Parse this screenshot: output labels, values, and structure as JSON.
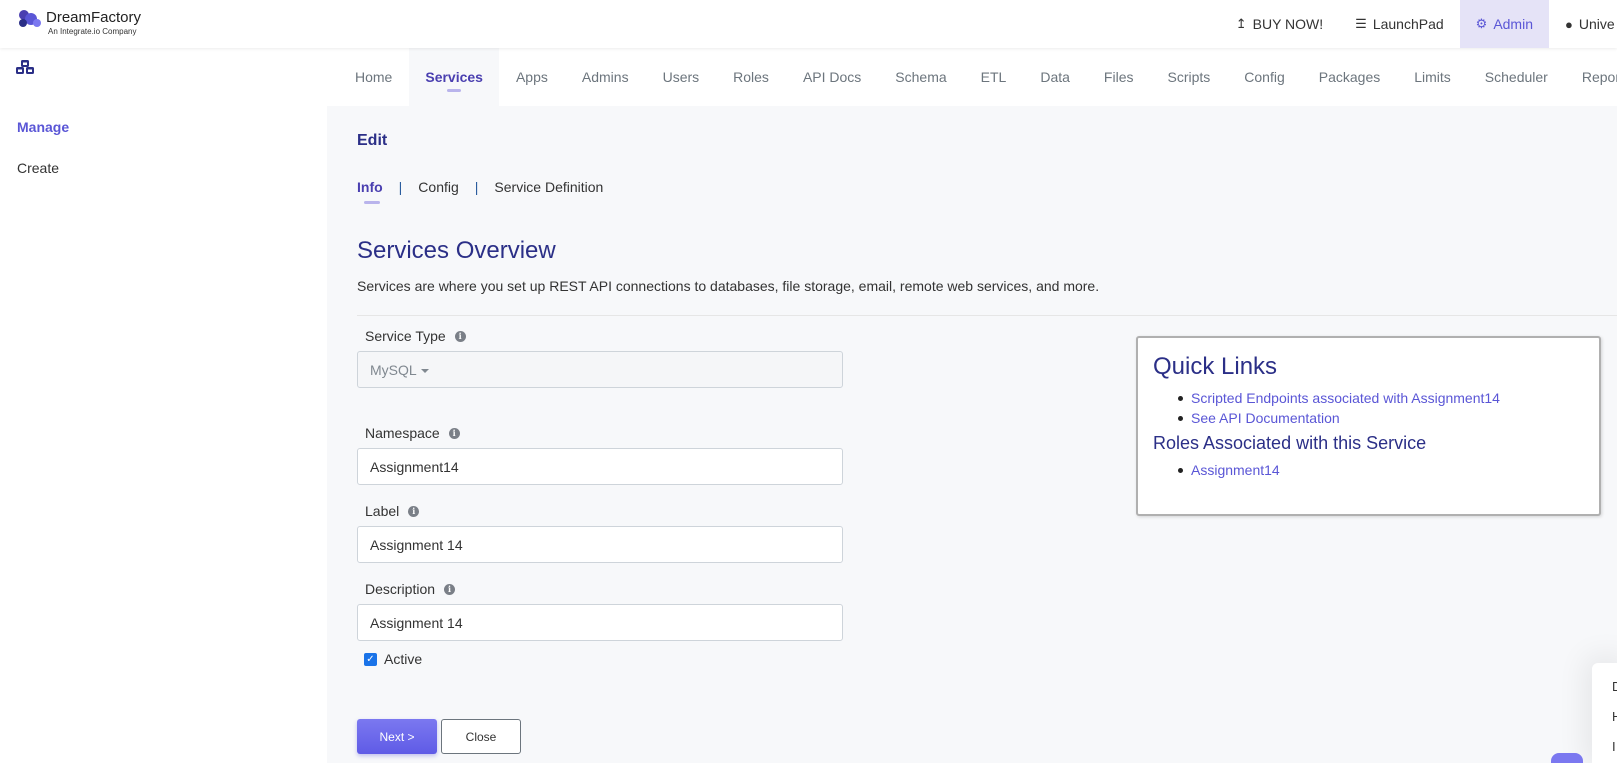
{
  "brand": {
    "name": "DreamFactory",
    "tagline": "An Integrate.io Company",
    "accent": "#5a56d6",
    "title_color": "#2b2f87"
  },
  "topnav": {
    "buy": {
      "icon": "upload-arrow-icon",
      "label": "BUY NOW!"
    },
    "launchpad": {
      "icon": "bars-icon",
      "label": "LaunchPad"
    },
    "admin": {
      "icon": "gear-icon",
      "label": "Admin"
    },
    "user": {
      "icon": "user-icon",
      "label": "Unive"
    }
  },
  "sidebar": {
    "icon": "apps-cluster-icon",
    "items": [
      {
        "label": "Manage",
        "active": true
      },
      {
        "label": "Create",
        "active": false
      }
    ]
  },
  "maintabs": [
    {
      "label": "Home"
    },
    {
      "label": "Services",
      "active": true
    },
    {
      "label": "Apps"
    },
    {
      "label": "Admins"
    },
    {
      "label": "Users"
    },
    {
      "label": "Roles"
    },
    {
      "label": "API Docs"
    },
    {
      "label": "Schema"
    },
    {
      "label": "ETL"
    },
    {
      "label": "Data"
    },
    {
      "label": "Files"
    },
    {
      "label": "Scripts"
    },
    {
      "label": "Config"
    },
    {
      "label": "Packages"
    },
    {
      "label": "Limits"
    },
    {
      "label": "Scheduler"
    },
    {
      "label": "Reports"
    }
  ],
  "edit": {
    "title": "Edit",
    "subtabs": [
      {
        "label": "Info",
        "active": true
      },
      {
        "label": "Config"
      },
      {
        "label": "Service Definition"
      }
    ],
    "separator": "|"
  },
  "overview": {
    "title": "Services Overview",
    "description": "Services are where you set up REST API connections to databases, file storage, email, remote web services, and more."
  },
  "form": {
    "service_type": {
      "label": "Service Type",
      "value": "MySQL"
    },
    "namespace": {
      "label": "Namespace",
      "value": "Assignment14"
    },
    "label": {
      "label": "Label",
      "value": "Assignment 14"
    },
    "description": {
      "label": "Description",
      "value": "Assignment 14"
    },
    "active": {
      "label": "Active",
      "checked": true
    },
    "info_icon": "info-circle-icon"
  },
  "buttons": {
    "next": "Next >",
    "close": "Close"
  },
  "quick_links": {
    "title": "Quick Links",
    "links": [
      "Scripted Endpoints associated with Assignment14",
      "See API Documentation"
    ],
    "roles_title": "Roles Associated with this Service",
    "roles": [
      "Assignment14"
    ]
  },
  "chat": {
    "lines": [
      "D",
      "H",
      "I"
    ]
  }
}
